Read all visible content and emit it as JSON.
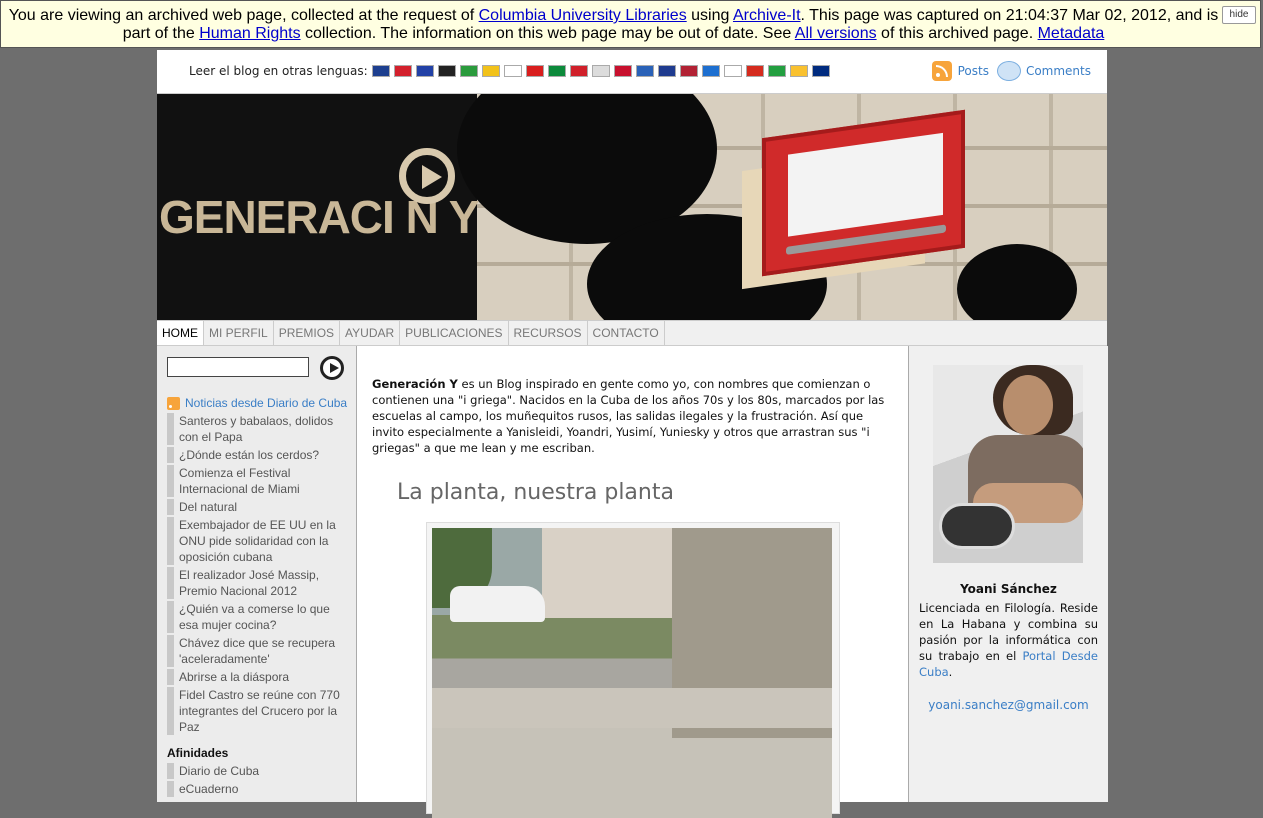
{
  "archive": {
    "text1": "You are viewing an archived web page, collected at the request of ",
    "link1": "Columbia University Libraries",
    "text2": " using ",
    "link2": "Archive-It",
    "text3": ". This page was captured on 21:04:37 Mar 02, 2012, and is part of the ",
    "link3": "Human Rights",
    "text4": " collection. The information on this web page may be out of date. See ",
    "link4": "All versions",
    "text5": " of this archived page. ",
    "link5": "Metadata",
    "hide": "hide"
  },
  "topbar": {
    "lang_label": "Leer el blog en otras lenguas:",
    "flags": [
      "#1d3f8f",
      "#d3202c",
      "#2241a6",
      "#222222",
      "#2b9b3d",
      "#f2c21a",
      "#ffffff",
      "#d91e1e",
      "#0c8a3b",
      "#d0202a",
      "#dcdcdc",
      "#c8102e",
      "#2a62b8",
      "#1f3b8f",
      "#b22234",
      "#1d6fd0",
      "#ffffff",
      "#d52b1e",
      "#239f40",
      "#f9c12f",
      "#002b7f"
    ],
    "posts": "Posts",
    "comments": "Comments"
  },
  "nav": [
    "HOME",
    "MI PERFIL",
    "PREMIOS",
    "AYUDAR",
    "PUBLICACIONES",
    "RECURSOS",
    "CONTACTO"
  ],
  "left": {
    "news_title": "Noticias desde Diario de Cuba",
    "news": [
      "Santeros y babalaos, dolidos con el Papa",
      "¿Dónde están los cerdos?",
      "Comienza el Festival Internacional de Miami",
      "Del natural",
      "Exembajador de EE UU en la ONU pide solidaridad con la oposición cubana",
      "El realizador José Massip, Premio Nacional 2012",
      "¿Quién va a comerse lo que esa mujer cocina?",
      "Chávez dice que se recupera 'aceleradamente'",
      "Abrirse a la diáspora",
      "Fidel Castro se reúne con 770 integrantes del Crucero por la Paz"
    ],
    "afinidades_title": "Afinidades",
    "afinidades": [
      "Diario de Cuba",
      "eCuaderno"
    ]
  },
  "center": {
    "intro_bold": "Generación Y",
    "intro_rest": " es un Blog inspirado en gente como yo, con nombres que comienzan o contienen una \"i griega\". Nacidos en la Cuba de los años 70s y los 80s, marcados por las escuelas al campo, los muñequitos rusos, las salidas ilegales y la frustración. Así que invito especialmente a Yanisleidi, Yoandri, Yusimí, Yuniesky y otros que arrastran sus \"i griegas\" a que me lean y me escriban.",
    "post_title": "La planta, nuestra planta"
  },
  "right": {
    "name": "Yoani Sánchez",
    "bio_text": "Licenciada en Filología. Reside en La Habana y combina su pasión por la informática con su trabajo en el ",
    "bio_link": "Portal Desde Cuba",
    "bio_end": ".",
    "email": "yoani.sanchez@gmail.com"
  },
  "banner": {
    "logo": "GENERACI N Y"
  }
}
